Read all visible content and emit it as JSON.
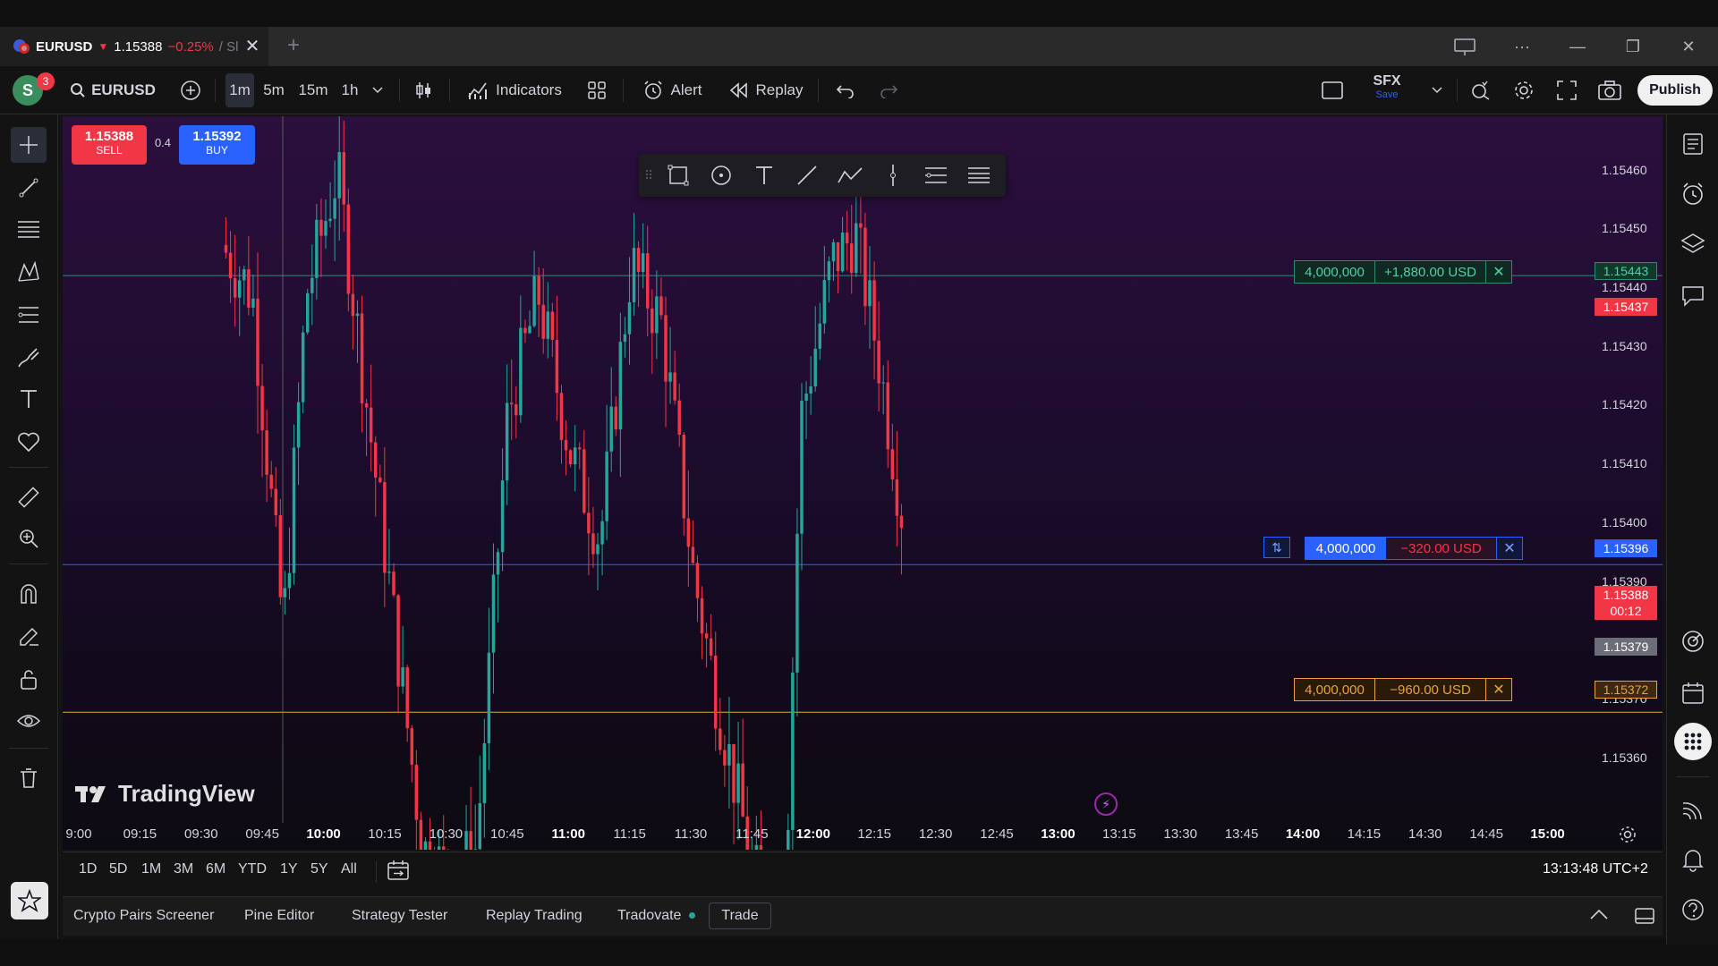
{
  "tab": {
    "symbol": "EURUSD",
    "arrow": "▼",
    "price": "1.15388",
    "change": "−0.25%",
    "rest": "/ Sl",
    "close": "✕",
    "add": "+"
  },
  "window": {
    "cast": "cast-icon",
    "more": "···",
    "minimize": "—",
    "restore": "❐",
    "close": "✕"
  },
  "toolbar": {
    "avatar_letter": "S",
    "notifications": "3",
    "symbol": "EURUSD",
    "intervals": [
      "1m",
      "5m",
      "15m",
      "1h"
    ],
    "active_interval": "1m",
    "indicators_label": "Indicators",
    "alert_label": "Alert",
    "replay_label": "Replay",
    "layout_name": "SFX",
    "layout_save": "Save",
    "publish_label": "Publish"
  },
  "order_widget": {
    "sell_price": "1.15388",
    "sell_label": "SELL",
    "spread": "0.4",
    "buy_price": "1.15392",
    "buy_label": "BUY"
  },
  "price_axis": {
    "labels": [
      "1.15460",
      "1.15450",
      "1.15440",
      "1.15430",
      "1.15420",
      "1.15410",
      "1.15400",
      "1.15390",
      "1.15370",
      "1.15360"
    ],
    "tags": {
      "tp": "1.15443",
      "red_level": "1.15437",
      "entry": "1.15396",
      "last": "1.15388",
      "countdown": "00:12",
      "grey": "1.15379",
      "sl": "1.15372"
    }
  },
  "positions": {
    "tp": {
      "qty": "4,000,000",
      "pnl": "+1,880.00 USD",
      "close": "✕"
    },
    "entry": {
      "reverse": "⇅",
      "qty": "4,000,000",
      "pnl": "−320.00 USD",
      "close": "✕"
    },
    "sl": {
      "qty": "4,000,000",
      "pnl": "−960.00 USD",
      "close": "✕"
    }
  },
  "time_axis": {
    "labels": [
      "9:00",
      "09:15",
      "09:30",
      "09:45",
      "10:00",
      "10:15",
      "10:30",
      "10:45",
      "11:00",
      "11:15",
      "11:30",
      "11:45",
      "12:00",
      "12:15",
      "12:30",
      "12:45",
      "13:00",
      "13:15",
      "13:30",
      "13:45",
      "14:00",
      "14:15",
      "14:30",
      "14:45",
      "15:00"
    ],
    "major": [
      "10:00",
      "11:00",
      "12:00",
      "13:00",
      "14:00",
      "15:00"
    ]
  },
  "range_bar": {
    "ranges": [
      "1D",
      "5D",
      "1M",
      "3M",
      "6M",
      "YTD",
      "1Y",
      "5Y",
      "All"
    ],
    "clock": "13:13:48 UTC+2"
  },
  "bottom_panel": {
    "tabs": [
      "Crypto Pairs Screener",
      "Pine Editor",
      "Strategy Tester",
      "Replay Trading",
      "Tradovate"
    ],
    "trade_label": "Trade"
  },
  "logo_text": "TradingView",
  "colors": {
    "up": "#26a69a",
    "down": "#f23645",
    "tp_line": "#2e8b6f",
    "entry_line": "#2962ff",
    "sl_line": "#e8a33a",
    "accent": "#2962ff"
  },
  "chart_data": {
    "type": "candlestick",
    "xlabel": "",
    "ylabel": "",
    "ylim": [
      1.15354,
      1.15466
    ],
    "levels": [
      1.15443,
      1.15396,
      1.15372
    ],
    "candles_note_seed": 7
  }
}
